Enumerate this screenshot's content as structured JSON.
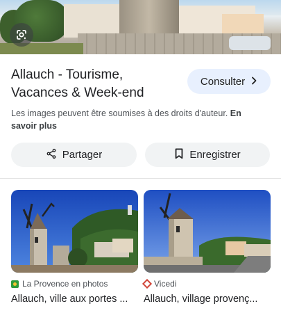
{
  "header": {
    "title": "Allauch - Tourisme, Vacances & Week-end",
    "consult_label": "Consulter",
    "consult_icon": "chevron-right-icon",
    "lens_icon": "google-lens-icon"
  },
  "notice": {
    "text": "Les images peuvent être soumises à des droits d'auteur.",
    "link": "En savoir plus"
  },
  "actions": {
    "share_label": "Partager",
    "share_icon": "share-icon",
    "save_label": "Enregistrer",
    "save_icon": "bookmark-icon"
  },
  "related": [
    {
      "source": "La Provence en photos",
      "caption": "Allauch, ville aux portes ..."
    },
    {
      "source": "Vicedi",
      "caption": "Allauch, village provenç..."
    }
  ],
  "colors": {
    "accent": "#1a73e8",
    "consult_bg": "#e8f0fe",
    "pill_bg": "#f1f3f4"
  }
}
